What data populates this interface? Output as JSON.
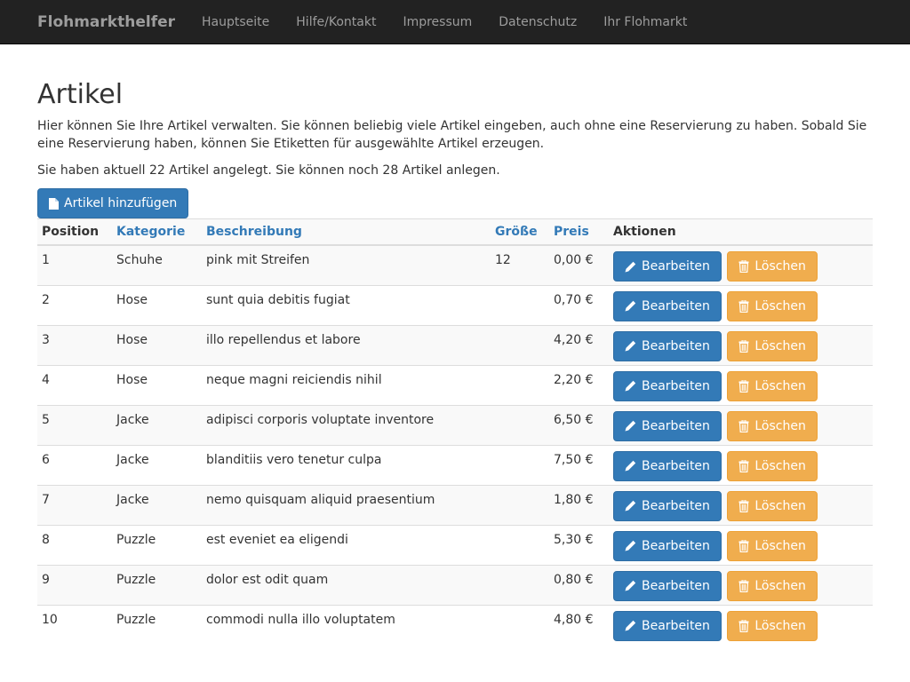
{
  "navbar": {
    "brand_bold": "Flohmarkt",
    "brand_rest": "helfer",
    "links": [
      "Hauptseite",
      "Hilfe/Kontakt",
      "Impressum",
      "Datenschutz",
      "Ihr Flohmarkt"
    ]
  },
  "page": {
    "title": "Artikel",
    "intro": "Hier können Sie Ihre Artikel verwalten. Sie können beliebig viele Artikel eingeben, auch ohne eine Reservierung zu haben. Sobald Sie eine Reservierung haben, können Sie Etiketten für ausgewählte Artikel erzeugen.",
    "count_text": "Sie haben aktuell 22 Artikel angelegt. Sie können noch 28 Artikel anlegen.",
    "add_button": "Artikel hinzufügen"
  },
  "table": {
    "headers": {
      "position": "Position",
      "kategorie": "Kategorie",
      "beschreibung": "Beschreibung",
      "groesse": "Größe",
      "preis": "Preis",
      "aktionen": "Aktionen"
    },
    "edit_label": "Bearbeiten",
    "delete_label": "Löschen",
    "rows": [
      {
        "position": "1",
        "kategorie": "Schuhe",
        "beschreibung": "pink mit Streifen",
        "groesse": "12",
        "preis": "0,00 €"
      },
      {
        "position": "2",
        "kategorie": "Hose",
        "beschreibung": "sunt quia debitis fugiat",
        "groesse": "",
        "preis": "0,70 €"
      },
      {
        "position": "3",
        "kategorie": "Hose",
        "beschreibung": "illo repellendus et labore",
        "groesse": "",
        "preis": "4,20 €"
      },
      {
        "position": "4",
        "kategorie": "Hose",
        "beschreibung": "neque magni reiciendis nihil",
        "groesse": "",
        "preis": "2,20 €"
      },
      {
        "position": "5",
        "kategorie": "Jacke",
        "beschreibung": "adipisci corporis voluptate inventore",
        "groesse": "",
        "preis": "6,50 €"
      },
      {
        "position": "6",
        "kategorie": "Jacke",
        "beschreibung": "blanditiis vero tenetur culpa",
        "groesse": "",
        "preis": "7,50 €"
      },
      {
        "position": "7",
        "kategorie": "Jacke",
        "beschreibung": "nemo quisquam aliquid praesentium",
        "groesse": "",
        "preis": "1,80 €"
      },
      {
        "position": "8",
        "kategorie": "Puzzle",
        "beschreibung": "est eveniet ea eligendi",
        "groesse": "",
        "preis": "5,30 €"
      },
      {
        "position": "9",
        "kategorie": "Puzzle",
        "beschreibung": "dolor est odit quam",
        "groesse": "",
        "preis": "0,80 €"
      },
      {
        "position": "10",
        "kategorie": "Puzzle",
        "beschreibung": "commodi nulla illo voluptatem",
        "groesse": "",
        "preis": "4,80 €"
      }
    ]
  },
  "icons": {
    "add": "file-icon",
    "edit": "pencil-icon",
    "delete": "trash-icon"
  },
  "colors": {
    "navbar": "#222222",
    "primary": "#337ab7",
    "warning": "#f0ad4e",
    "link": "#337ab7"
  }
}
